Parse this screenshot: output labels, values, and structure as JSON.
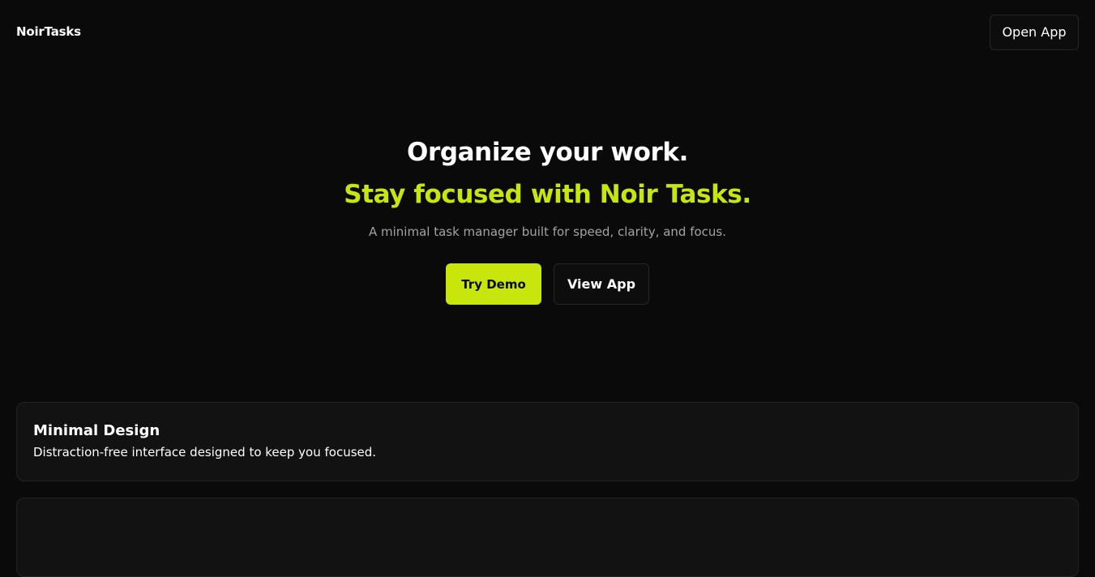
{
  "nav": {
    "brand": "NoirTasks",
    "open_app_label": "Open App"
  },
  "hero": {
    "title": "Organize your work.",
    "subtitle": "Stay focused with Noir Tasks.",
    "description": "A minimal task manager built for speed, clarity, and focus.",
    "primary_cta": "Try Demo",
    "secondary_cta": "View App"
  },
  "features": [
    {
      "title": "Minimal Design",
      "description": "Distraction-free interface designed to keep you focused."
    }
  ],
  "colors": {
    "background": "#0a0a0a",
    "accent": "#c8e60b",
    "card": "#121212",
    "muted_text": "#a3a3a3"
  }
}
